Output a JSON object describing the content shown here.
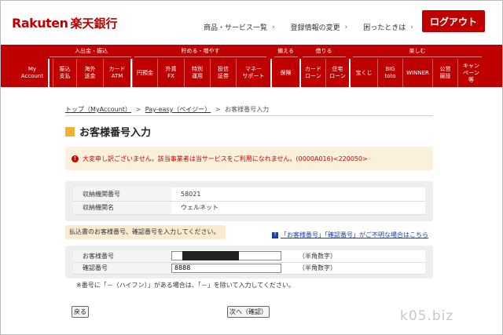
{
  "brand": {
    "logo_en": "Rakuten",
    "logo_jp": "楽天銀行",
    "color": "#bf0000"
  },
  "header": {
    "links": [
      "商品・サービス一覧",
      "登録情報の変更",
      "困ったときは"
    ],
    "logout_label": "ログアウト"
  },
  "nav": {
    "categories": [
      "入出金・振込",
      "貯める・増やす",
      "備える",
      "借りる",
      "楽しむ"
    ],
    "items": [
      "My\nAccount",
      "振込\n支払",
      "海外\n送金",
      "カード\nATM",
      "円預金",
      "外貨\nFX",
      "特別\n運用",
      "投信\n証券",
      "マネー\nサポート",
      "保険",
      "カード\nローン",
      "住宅\nローン",
      "宝くじ",
      "BIG\ntoto",
      "WINNER",
      "公営\n競技",
      "キャン\nペーン\n等"
    ]
  },
  "breadcrumb": {
    "items": [
      "トップ（MyAccount）",
      "Pay-easy（ペイジー）",
      "お客様番号入力"
    ],
    "separator": ">"
  },
  "page": {
    "title": "お客様番号入力",
    "error_message": "大変申し訳ございません。該当事業者は当サービスをご利用になれません。(0000A016)<220050>",
    "info_rows": [
      {
        "label": "収納機関番号",
        "value": "58021"
      },
      {
        "label": "収納機関名",
        "value": "ウェルネット"
      }
    ],
    "instruction": "払込書のお客様番号、確認番号を入力してください。",
    "help_link": "「お客様番号」「確認番号」がご不明な場合はこちら",
    "inputs": [
      {
        "label": "お客様番号",
        "value": "",
        "hint": "（半角数字）"
      },
      {
        "label": "確認番号",
        "value": "8888",
        "hint": "（半角数字）"
      }
    ],
    "note": "※番号に「－（ハイフン）」がある場合は、「－」を除いて入力してください。",
    "back_label": "戻る",
    "next_label": "次へ（確認）"
  },
  "watermark": "k05.biz"
}
